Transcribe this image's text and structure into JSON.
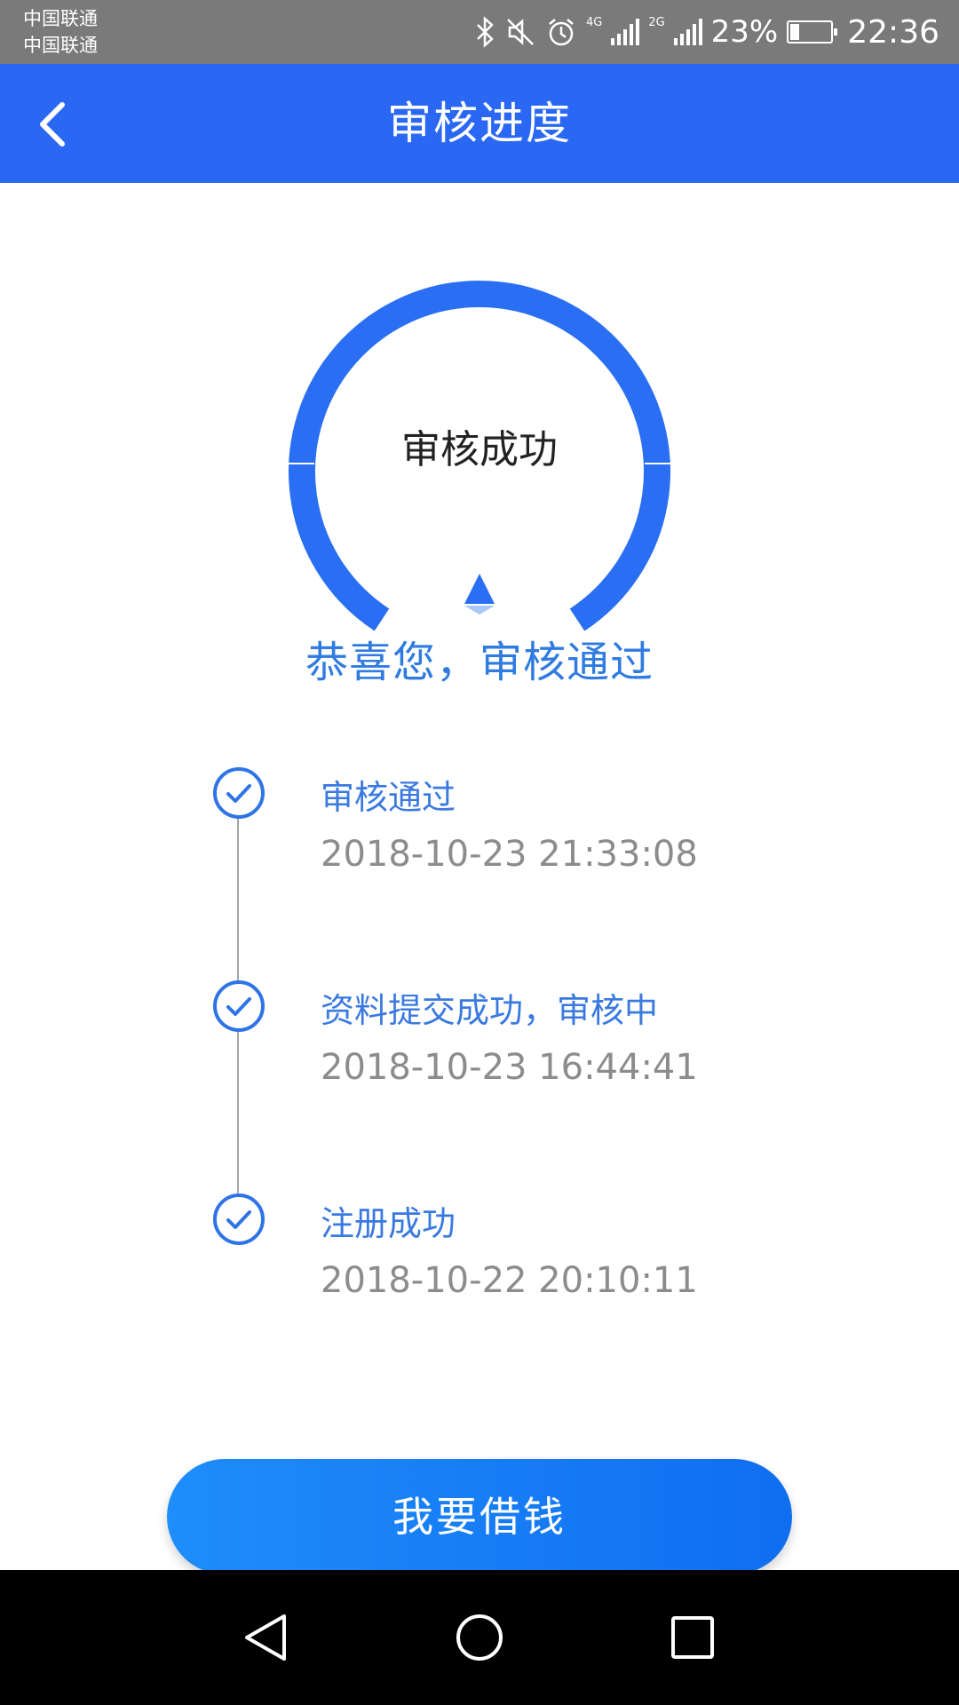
{
  "status_bar": {
    "carrier_1": "中国联通",
    "carrier_2": "中国联通",
    "network_1": "4G",
    "network_2": "2G",
    "battery_percent_text": "23%",
    "battery_level": 0.23,
    "time": "22:36",
    "icons": [
      "bluetooth-icon",
      "mute-icon",
      "alarm-icon",
      "signal-icon",
      "signal-icon",
      "battery-icon"
    ]
  },
  "header": {
    "title": "审核进度",
    "back_icon": "chevron-left-icon",
    "background": "#2a68f3"
  },
  "gauge": {
    "label": "审核成功",
    "color": "#2a6ff3"
  },
  "result": {
    "message": "恭喜您，审核通过"
  },
  "timeline": {
    "items": [
      {
        "title": "审核通过",
        "time": "2018-10-23 21:33:08"
      },
      {
        "title": "资料提交成功，审核中",
        "time": "2018-10-23 16:44:41"
      },
      {
        "title": "注册成功",
        "time": "2018-10-22 20:10:11"
      }
    ],
    "accent": "#3a7ae0"
  },
  "action": {
    "button_label": "我要借钱"
  },
  "nav_bar": {
    "icons": [
      "back-triangle-icon",
      "home-circle-icon",
      "recents-square-icon"
    ]
  }
}
